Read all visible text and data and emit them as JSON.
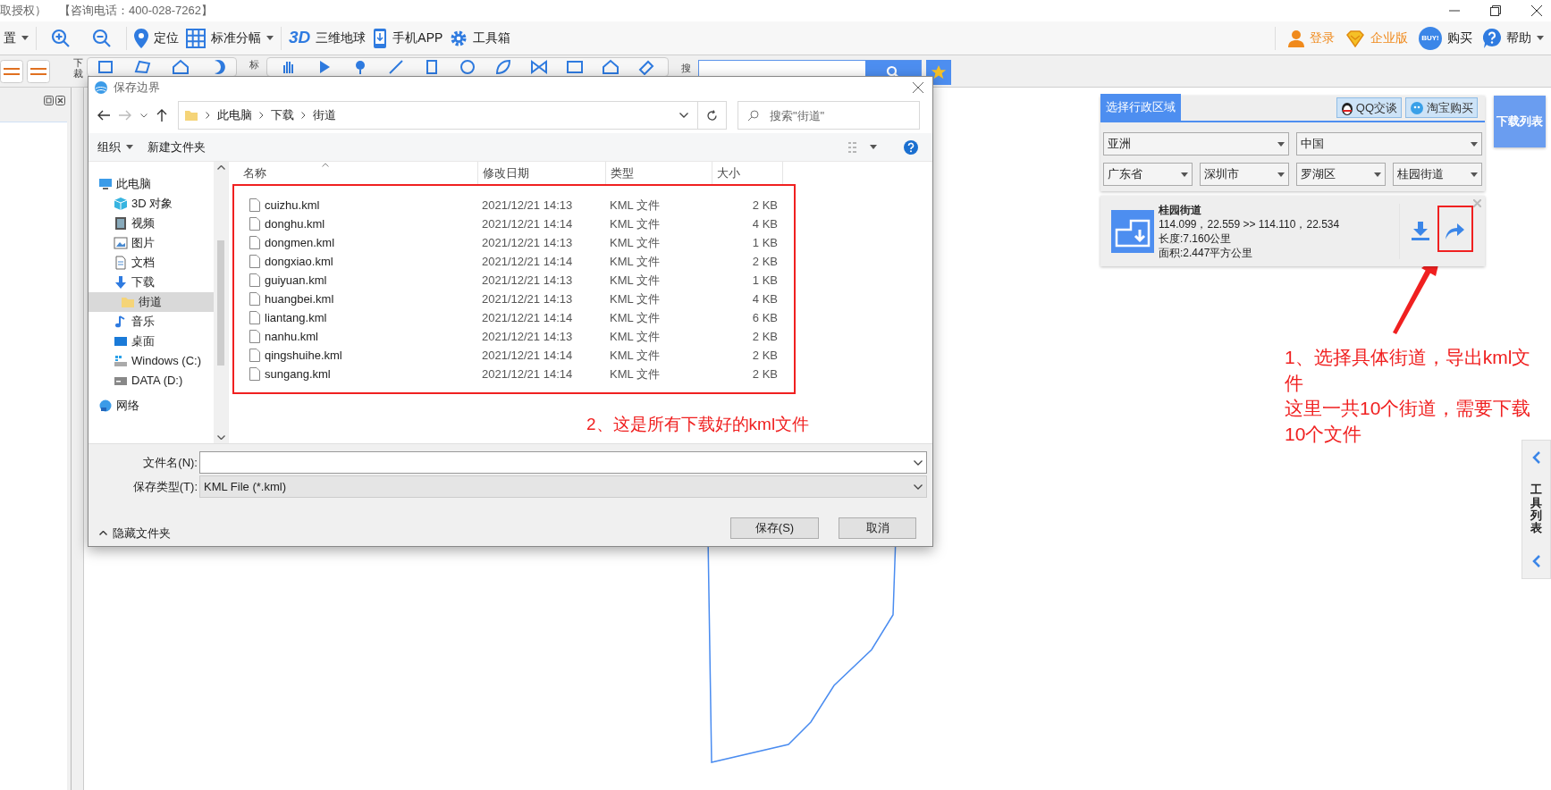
{
  "title_bar": {
    "texts": [
      "取授权）",
      "【咨询电话：400-028-7262】"
    ]
  },
  "main_toolbar": {
    "left": [
      {
        "kind": "menu",
        "label": "置",
        "dropdown": true
      },
      {
        "kind": "zoom-in",
        "dropdown": false
      },
      {
        "kind": "zoom-out",
        "dropdown": false
      },
      {
        "kind": "locate",
        "label": "定位",
        "dropdown": false
      },
      {
        "kind": "grid",
        "label": "标准分幅",
        "dropdown": true
      },
      {
        "kind": "globe",
        "badge": "3D",
        "label": "三维地球",
        "dropdown": false
      },
      {
        "kind": "phone",
        "label": "手机APP",
        "dropdown": false
      },
      {
        "kind": "gear",
        "label": "工具箱",
        "dropdown": false
      }
    ],
    "right": [
      {
        "kind": "user",
        "label": "登录",
        "dropdown": false
      },
      {
        "kind": "vip",
        "label": "企业版",
        "dropdown": false
      },
      {
        "kind": "buy",
        "badge": "BUY!",
        "label": "购买",
        "dropdown": false
      },
      {
        "kind": "help",
        "label": "帮助",
        "dropdown": true
      }
    ]
  },
  "tool_bar": {
    "group_labels": [
      "下裁",
      "标",
      "搜"
    ]
  },
  "dialog": {
    "title": "保存边界",
    "path": [
      "此电脑",
      "下载",
      "街道"
    ],
    "search_placeholder": "搜索\"街道\"",
    "commands": [
      {
        "label": "组织",
        "dropdown": true
      },
      {
        "label": "新建文件夹",
        "dropdown": false
      }
    ],
    "nav": [
      {
        "kind": "pc",
        "label": "此电脑",
        "selected": false,
        "children": [
          {
            "kind": "cube",
            "label": "3D 对象",
            "selected": false
          },
          {
            "kind": "video",
            "label": "视频",
            "selected": false
          },
          {
            "kind": "picture",
            "label": "图片",
            "selected": false
          },
          {
            "kind": "doc",
            "label": "文档",
            "selected": false
          },
          {
            "kind": "download",
            "label": "下载",
            "selected": false,
            "children": [
              {
                "kind": "folder",
                "label": "街道",
                "selected": true
              }
            ]
          },
          {
            "kind": "music",
            "label": "音乐",
            "selected": false
          },
          {
            "kind": "desktop",
            "label": "桌面",
            "selected": false
          },
          {
            "kind": "windrive",
            "label": "Windows (C:)",
            "selected": false
          },
          {
            "kind": "drive",
            "label": "DATA (D:)",
            "selected": false
          }
        ]
      },
      {
        "kind": "network",
        "label": "网络",
        "selected": false
      }
    ],
    "columns": [
      "名称",
      "修改日期",
      "类型",
      "大小"
    ],
    "files": [
      {
        "name": "cuizhu.kml",
        "modified": "2021/12/21 14:13",
        "type": "KML 文件",
        "size": "2 KB"
      },
      {
        "name": "donghu.kml",
        "modified": "2021/12/21 14:14",
        "type": "KML 文件",
        "size": "4 KB"
      },
      {
        "name": "dongmen.kml",
        "modified": "2021/12/21 14:13",
        "type": "KML 文件",
        "size": "1 KB"
      },
      {
        "name": "dongxiao.kml",
        "modified": "2021/12/21 14:14",
        "type": "KML 文件",
        "size": "2 KB"
      },
      {
        "name": "guiyuan.kml",
        "modified": "2021/12/21 14:13",
        "type": "KML 文件",
        "size": "1 KB"
      },
      {
        "name": "huangbei.kml",
        "modified": "2021/12/21 14:13",
        "type": "KML 文件",
        "size": "4 KB"
      },
      {
        "name": "liantang.kml",
        "modified": "2021/12/21 14:14",
        "type": "KML 文件",
        "size": "6 KB"
      },
      {
        "name": "nanhu.kml",
        "modified": "2021/12/21 14:13",
        "type": "KML 文件",
        "size": "2 KB"
      },
      {
        "name": "qingshuihe.kml",
        "modified": "2021/12/21 14:14",
        "type": "KML 文件",
        "size": "2 KB"
      },
      {
        "name": "sungang.kml",
        "modified": "2021/12/21 14:14",
        "type": "KML 文件",
        "size": "2 KB"
      }
    ],
    "filename_label": "文件名(N):",
    "filetype_label": "保存类型(T):",
    "filetype": "KML File (*.kml)",
    "hide_folders": "隐藏文件夹",
    "buttons": [
      "保存(S)",
      "取消"
    ]
  },
  "region_panel": {
    "tab": "选择行政区域",
    "buttons": [
      {
        "kind": "qq",
        "label": "QQ交谈"
      },
      {
        "kind": "taobao",
        "label": "淘宝购买"
      }
    ],
    "selects": [
      [
        "亚洲",
        "中国"
      ],
      [
        "广东省",
        "深圳市",
        "罗湖区",
        "桂园街道"
      ]
    ],
    "result": {
      "name": "桂园街道",
      "coords": "114.099，22.559 >> 114.110，22.534",
      "length": "长度:7.160公里",
      "area": "面积:2.447平方公里"
    }
  },
  "download_list": "下载列表",
  "side_tab": "工具列表",
  "annotations": [
    {
      "lines": [
        "2、这是所有下载好的kml文件"
      ]
    },
    {
      "lines": [
        "1、选择具体街道，导出kml文件",
        "这里一共10个街道，需要下载10个文件"
      ]
    }
  ]
}
